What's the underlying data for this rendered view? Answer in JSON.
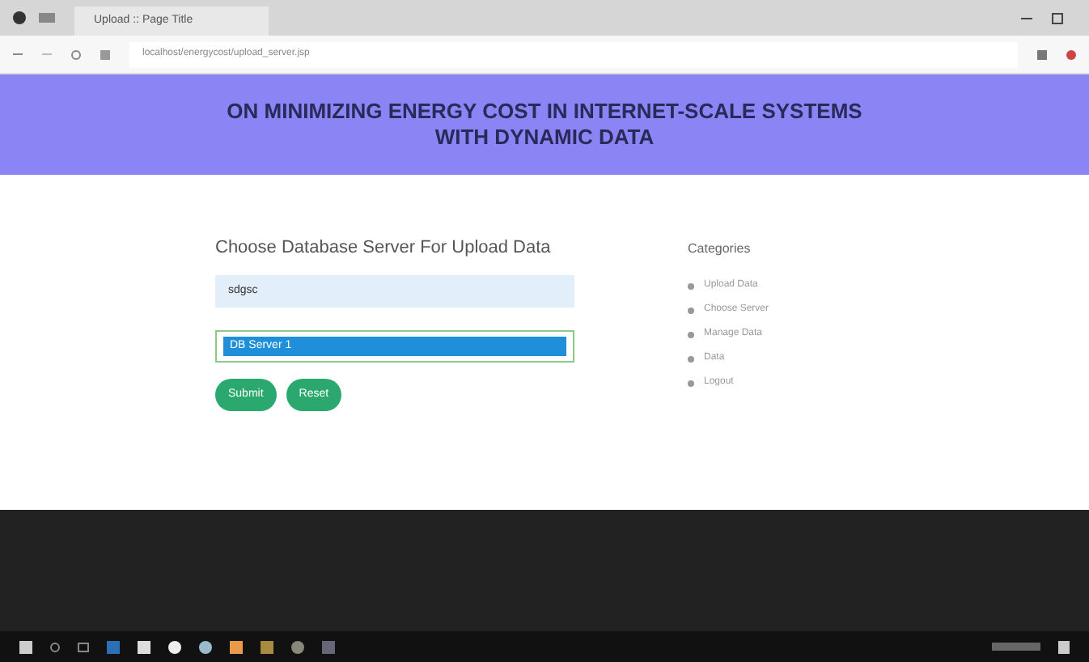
{
  "browser": {
    "tab_title": "Upload :: Page Title",
    "url": "localhost/energycost/upload_server.jsp"
  },
  "header": {
    "title_lines": [
      "ON MINIMIZING ENERGY COST IN INTERNET-SCALE SYSTEMS",
      "WITH DYNAMIC DATA"
    ]
  },
  "form": {
    "heading": "Choose Database Server For Upload Data",
    "name_field": {
      "value": "sdgsc"
    },
    "server_select": {
      "value": "DB Server 1"
    },
    "buttons": [
      "Submit",
      "Reset"
    ]
  },
  "categories": {
    "title": "Categories",
    "items": [
      "Upload Data",
      "Choose Server",
      "Manage Data",
      "Data",
      "Logout"
    ]
  }
}
